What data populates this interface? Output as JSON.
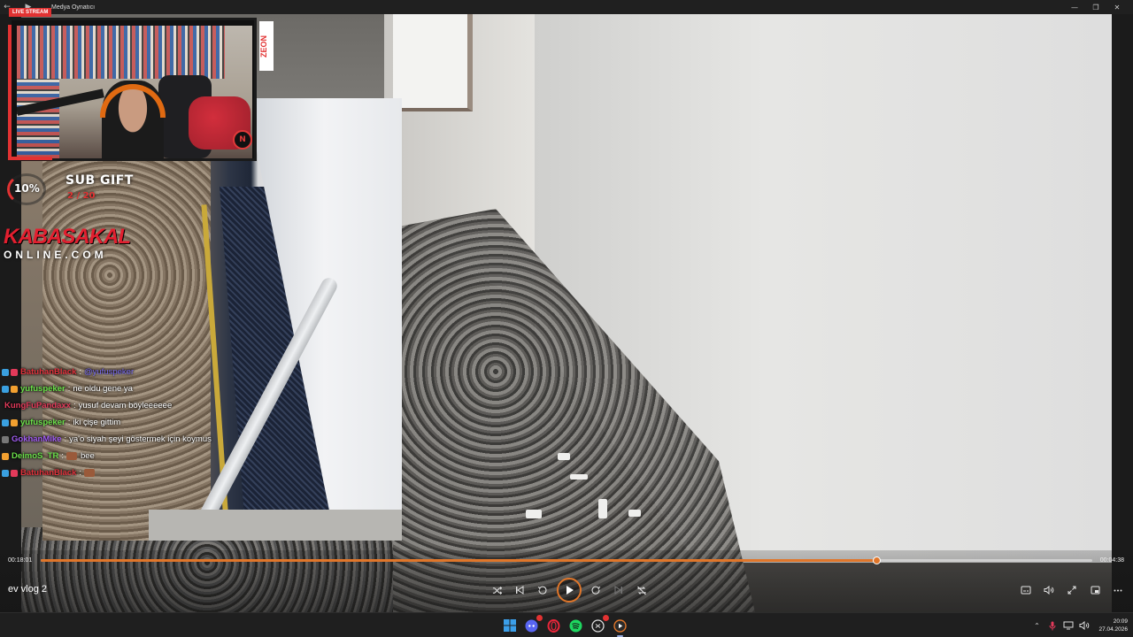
{
  "window": {
    "title": "Medya Oynatıcı",
    "minimize_icon": "minimize-icon",
    "restore_icon": "restore-icon",
    "close_icon": "close-icon"
  },
  "overlay": {
    "live_badge": "LIVE STREAM",
    "sponsor_vertical": "ZEON",
    "progress_percent": "10%",
    "progress_value": 0.1,
    "sub_gift_label": "SUB GIFT",
    "sub_gift_count": "2 / 20",
    "brand_name": "KABASAKAL",
    "brand_domain": "ONLINE.COM"
  },
  "chat": [
    {
      "user": "BatuhanBlack",
      "user_color": "#e0323c",
      "message": "@yufuspeker",
      "message_color": "#7a6cf0",
      "badges": [
        "#3aa0e0",
        "#e23a5a"
      ]
    },
    {
      "user": "yufuspeker",
      "user_color": "#6be04a",
      "message": "ne oldu gene ya",
      "message_color": "#ffffff",
      "badges": [
        "#3aa0e0",
        "#f2a030"
      ]
    },
    {
      "user": "KungFuPandaxx",
      "user_color": "#e23a5a",
      "message": "yusuf devam böyleeeeee",
      "message_color": "#ffffff",
      "badges": []
    },
    {
      "user": "yufuspeker",
      "user_color": "#6be04a",
      "message": "iki çişe gittim",
      "message_color": "#ffffff",
      "badges": [
        "#3aa0e0",
        "#f2a030"
      ]
    },
    {
      "user": "GokhanMike",
      "user_color": "#a05cf0",
      "message": "ya'o siyah şeyi göstermek için koymus",
      "message_color": "#ffffff",
      "badges": [
        "#777777"
      ]
    },
    {
      "user": "DeimoS_TR",
      "user_color": "#6be04a",
      "message": "bee",
      "message_color": "#ffffff",
      "badges": [
        "#f2a030"
      ]
    },
    {
      "user": "BatuhanBlack",
      "user_color": "#e0323c",
      "message": "",
      "message_color": "#ffffff",
      "badges": [
        "#3aa0e0",
        "#e23a5a"
      ]
    }
  ],
  "player": {
    "current_time": "00:18:01",
    "total_time": "00:04:38",
    "progress": 0.795,
    "video_title": "ev vlog 2",
    "accent_color": "#e0762a",
    "controls": {
      "shuffle_icon": "shuffle-icon",
      "previous_icon": "previous-icon",
      "rewind_icon": "rewind-10-icon",
      "play_icon": "play-icon",
      "forward_icon": "forward-30-icon",
      "next_icon": "next-icon",
      "repeat_icon": "repeat-off-icon",
      "subtitles_icon": "subtitles-icon",
      "volume_icon": "volume-icon",
      "fullscreen_icon": "fullscreen-icon",
      "miniplayer_icon": "miniplayer-icon",
      "more_icon": "more-options-icon"
    }
  },
  "taskbar": {
    "apps": [
      "windows-start-icon",
      "discord-icon",
      "opera-gx-icon",
      "spotify-icon",
      "chatgpt-icon",
      "media-player-icon"
    ],
    "tray": [
      "chevron-up-icon",
      "microphone-icon",
      "network-icon",
      "volume-icon"
    ],
    "time": "20:09",
    "date": "27.04.2026"
  }
}
